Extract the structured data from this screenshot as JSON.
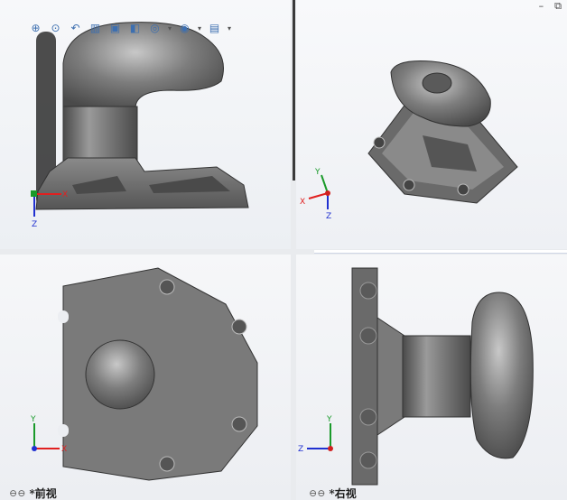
{
  "toolbar": {
    "icons": [
      "zoom-to-fit-icon",
      "zoom-area-icon",
      "previous-view-icon",
      "section-view-icon",
      "view-orientation-icon",
      "display-style-icon",
      "hide-show-icon",
      "appearance-icon",
      "scene-icon"
    ],
    "glyphs": [
      "⊕",
      "⊙",
      "↶",
      "▥",
      "▣",
      "◧",
      "◎",
      "◉",
      "▤"
    ]
  },
  "window": {
    "minimize": "–",
    "restore": "⧉"
  },
  "viewports": {
    "bottom_left": {
      "label": "*前视"
    },
    "bottom_right": {
      "label": "*右视"
    }
  },
  "axes": {
    "x": "X",
    "y": "Y",
    "z": "Z"
  },
  "link_glyph": "⊖⊖",
  "colors": {
    "model": "#6e6e6e",
    "x_axis": "#e02020",
    "y_axis": "#1a9a2a",
    "z_axis": "#2030d0"
  }
}
